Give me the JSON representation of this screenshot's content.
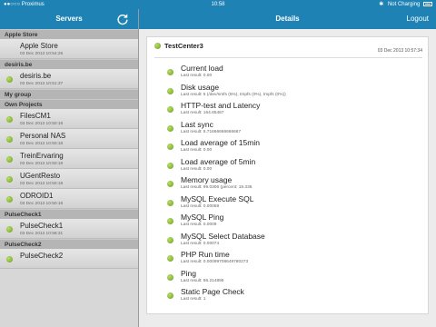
{
  "statusbar": {
    "carrier": "●●○○○ Proximus",
    "time": "10:58",
    "battery_text": "Not Charging"
  },
  "sidebar_nav": {
    "title": "Servers"
  },
  "details_nav": {
    "title": "Details",
    "logout_label": "Logout"
  },
  "groups": [
    {
      "header": "Apple Store",
      "servers": [
        {
          "name": "Apple Store",
          "date": "03 Dec 2013 10:54:26",
          "dot": false
        }
      ]
    },
    {
      "header": "desiris.be",
      "servers": [
        {
          "name": "desiris.be",
          "date": "03 Dec 2013 10:51:37",
          "dot": true
        }
      ]
    },
    {
      "header": "My group",
      "servers": []
    },
    {
      "header": "Own Projects",
      "servers": [
        {
          "name": "FilesCM1",
          "date": "03 Dec 2013 10:50:18",
          "dot": true
        },
        {
          "name": "Personal NAS",
          "date": "03 Dec 2013 10:50:18",
          "dot": true
        },
        {
          "name": "TreinErvaring",
          "date": "03 Dec 2013 10:50:18",
          "dot": true
        },
        {
          "name": "UGentResto",
          "date": "03 Dec 2013 10:50:18",
          "dot": true
        },
        {
          "name": "ODROID1",
          "date": "03 Dec 2013 10:50:18",
          "dot": true
        }
      ]
    },
    {
      "header": "PulseCheck1",
      "servers": [
        {
          "name": "PulseCheck1",
          "date": "03 Dec 2013 10:58:31",
          "dot": true
        }
      ]
    },
    {
      "header": "PulseCheck2",
      "servers": [
        {
          "name": "PulseCheck2",
          "date": "",
          "dot": true
        }
      ]
    }
  ],
  "details": {
    "server_name": "TestCenter3",
    "timestamp": "03 Dec 2013 10:57:34",
    "checks": [
      {
        "name": "Current load",
        "result": "Last result: 0.00"
      },
      {
        "name": "Disk usage",
        "result": "Last result: 5 (/dev/smfs (5%), tmpfs (0%), tmpfs (0%))"
      },
      {
        "name": "HTTP-test and Latency",
        "result": "Last result: 164.65467"
      },
      {
        "name": "Last sync",
        "result": "Last result: 5.71666666666667"
      },
      {
        "name": "Load average of 15min",
        "result": "Last result: 0.00"
      },
      {
        "name": "Load average of 5min",
        "result": "Last result: 0.00"
      },
      {
        "name": "Memory usage",
        "result": "Last result: 99.0306 (percent: 19.336"
      },
      {
        "name": "MySQL Execute SQL",
        "result": "Last result: 0.00058"
      },
      {
        "name": "MySQL Ping",
        "result": "Last result: 0.0009"
      },
      {
        "name": "MySQL Select Database",
        "result": "Last result: 0.00074"
      },
      {
        "name": "PHP Run time",
        "result": "Last result: 0.00099708649780273"
      },
      {
        "name": "Ping",
        "result": "Last result: 86.214895"
      },
      {
        "name": "Static Page Check",
        "result": "Last result: 1"
      }
    ]
  },
  "colors": {
    "accent": "#1e82b4",
    "status_ok": "#8cc63f"
  }
}
